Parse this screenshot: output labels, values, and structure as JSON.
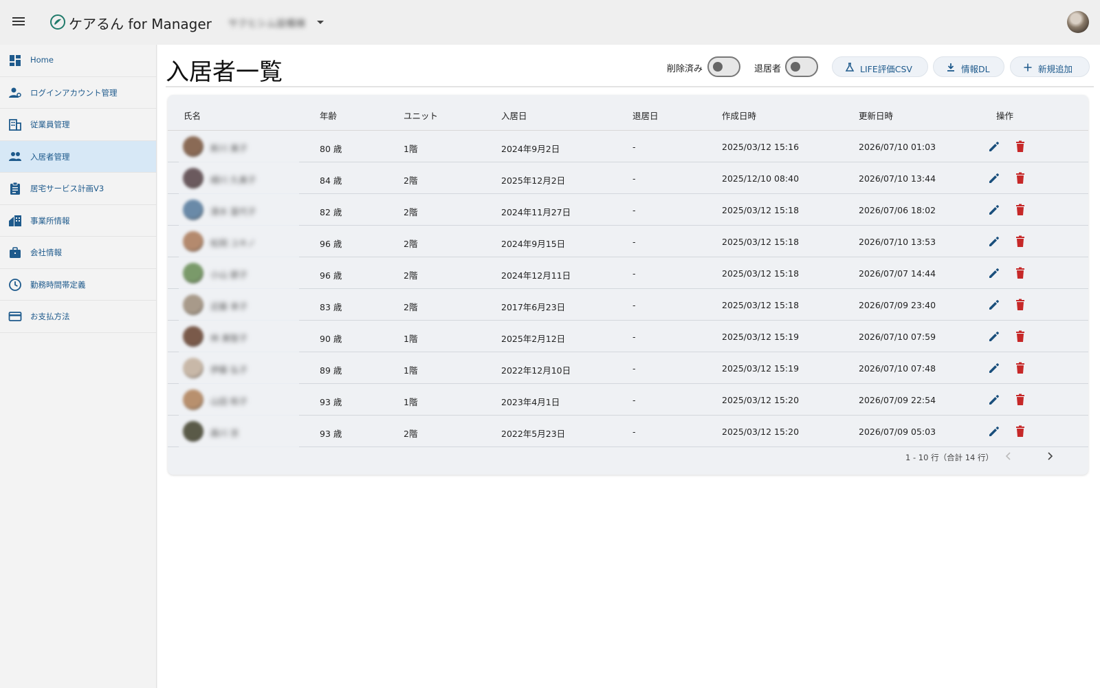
{
  "app": {
    "title": "ケアるん for Manager",
    "facility_name": "サクヒシム設備棟"
  },
  "sidebar": {
    "items": [
      {
        "label": "Home",
        "icon": "dashboard-icon",
        "active": false
      },
      {
        "label": "ログインアカウント管理",
        "icon": "account-manage-icon",
        "active": false
      },
      {
        "label": "従業員管理",
        "icon": "employees-icon",
        "active": false
      },
      {
        "label": "入居者管理",
        "icon": "residents-icon",
        "active": true
      },
      {
        "label": "居宅サービス計画V3",
        "icon": "clipboard-icon",
        "active": false
      },
      {
        "label": "事業所情報",
        "icon": "office-icon",
        "active": false
      },
      {
        "label": "会社情報",
        "icon": "briefcase-icon",
        "active": false
      },
      {
        "label": "勤務時間帯定義",
        "icon": "clock-icon",
        "active": false
      },
      {
        "label": "お支払方法",
        "icon": "credit-card-icon",
        "active": false
      }
    ]
  },
  "page": {
    "title": "入居者一覧",
    "toggles": {
      "deleted_label": "削除済み",
      "deleted_on": false,
      "moved_out_label": "退居者",
      "moved_out_on": false
    },
    "buttons": {
      "life_csv": "LIFE評価CSV",
      "info_dl": "情報DL",
      "add_new": "新規追加"
    }
  },
  "table": {
    "headers": {
      "name": "氏名",
      "age": "年齢",
      "unit": "ユニット",
      "move_in": "入居日",
      "move_out": "退居日",
      "created": "作成日時",
      "updated": "更新日時",
      "actions": "操作"
    },
    "rows": [
      {
        "name": "新川 美子",
        "age": "80 歳",
        "unit": "1階",
        "move_in": "2024年9月2日",
        "move_out": "-",
        "created": "2025/03/12 15:16",
        "updated": "2026/07/10 01:03",
        "avatar_color": "#8a6a55"
      },
      {
        "name": "細川 久美子",
        "age": "84 歳",
        "unit": "2階",
        "move_in": "2025年12月2日",
        "move_out": "-",
        "created": "2025/12/10 08:40",
        "updated": "2026/07/10 13:44",
        "avatar_color": "#6b5a5e"
      },
      {
        "name": "清水 冨代子",
        "age": "82 歳",
        "unit": "2階",
        "move_in": "2024年11月27日",
        "move_out": "-",
        "created": "2025/03/12 15:18",
        "updated": "2026/07/06 18:02",
        "avatar_color": "#6a8aa8"
      },
      {
        "name": "松岡 ユキノ",
        "age": "96 歳",
        "unit": "2階",
        "move_in": "2024年9月15日",
        "move_out": "-",
        "created": "2025/03/12 15:18",
        "updated": "2026/07/10 13:53",
        "avatar_color": "#b48a6e"
      },
      {
        "name": "小山 節子",
        "age": "96 歳",
        "unit": "2階",
        "move_in": "2024年12月11日",
        "move_out": "-",
        "created": "2025/03/12 15:18",
        "updated": "2026/07/07 14:44",
        "avatar_color": "#7a9a6a"
      },
      {
        "name": "近藤 幸子",
        "age": "83 歳",
        "unit": "2階",
        "move_in": "2017年6月23日",
        "move_out": "-",
        "created": "2025/03/12 15:18",
        "updated": "2026/07/09 23:40",
        "avatar_color": "#a89a8a"
      },
      {
        "name": "林 美智子",
        "age": "90 歳",
        "unit": "1階",
        "move_in": "2025年2月12日",
        "move_out": "-",
        "created": "2025/03/12 15:19",
        "updated": "2026/07/10 07:59",
        "avatar_color": "#7a5a4a"
      },
      {
        "name": "伊藤 弘子",
        "age": "89 歳",
        "unit": "1階",
        "move_in": "2022年12月10日",
        "move_out": "-",
        "created": "2025/03/12 15:19",
        "updated": "2026/07/10 07:48",
        "avatar_color": "#c8b8a8"
      },
      {
        "name": "山田 和子",
        "age": "93 歳",
        "unit": "1階",
        "move_in": "2023年4月1日",
        "move_out": "-",
        "created": "2025/03/12 15:20",
        "updated": "2026/07/09 22:54",
        "avatar_color": "#b8906e"
      },
      {
        "name": "森川 京",
        "age": "93 歳",
        "unit": "2階",
        "move_in": "2022年5月23日",
        "move_out": "-",
        "created": "2025/03/12 15:20",
        "updated": "2026/07/09 05:03",
        "avatar_color": "#5a5a48"
      }
    ],
    "pagination": "1 - 10 行（合計 14 行）"
  },
  "colors": {
    "accent": "#1e5a8c",
    "edit_icon": "#1a4f7c",
    "delete_icon": "#c62828",
    "active_nav_bg": "#d7e8f6"
  }
}
